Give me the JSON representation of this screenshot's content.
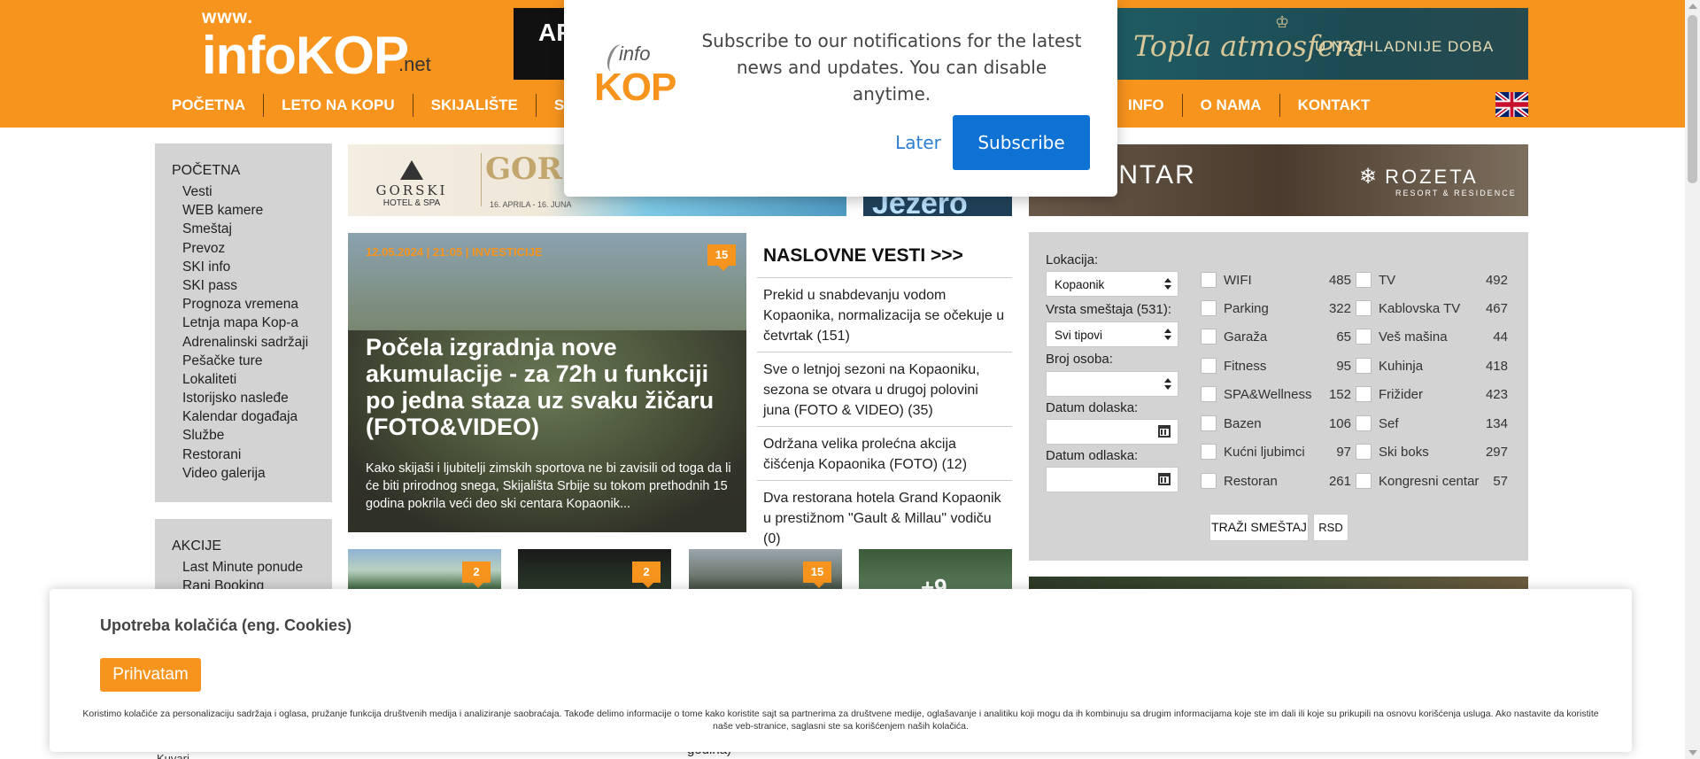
{
  "header": {
    "logo_www": "www.",
    "logo_name": "infoKOP",
    "logo_tld": ".net",
    "top_ad_left_text": "AP",
    "top_ad_right_script": "Topla atmosfera",
    "top_ad_right_caps": "U NAJHLADNIJE DOBA"
  },
  "nav": {
    "left": [
      "POČETNA",
      "LETO NA KOPU",
      "SKIJALIŠTE",
      "SMEŠTAJ"
    ],
    "right": [
      "INFO",
      "O NAMA",
      "KONTAKT"
    ],
    "language_flag": "uk-flag-icon"
  },
  "sidebar": {
    "section1_title": "POČETNA",
    "section1_items": [
      "Vesti",
      "WEB kamere",
      "Smeštaj",
      "Prevoz",
      "SKI info",
      "SKI pass",
      "Prognoza vremena",
      "Letnja mapa Kop-a",
      "Adrenalinski sadržaji",
      "Pešačke ture",
      "Lokaliteti",
      "Istorijsko nasleđe",
      "Kalendar događaja",
      "Službe",
      "Restorani",
      "Video galerija"
    ],
    "section2_title": "AKCIJE",
    "section2_items": [
      "Last Minute ponude",
      "Rani Booking"
    ],
    "bottom_peek": "Kuvari"
  },
  "ads": {
    "gorski_brand": "GORSKI",
    "gorski_brand_sub": "HOTEL & SPA",
    "gorski_script": "GORSKI refresh",
    "gorski_dates": "16. APRILA - 16. JUNA",
    "jezero": "Jezero",
    "rozeta_word": "A CENTAR",
    "rozeta_logo": "ROZETA",
    "rozeta_sub": "RESORT & RESIDENCE"
  },
  "featured": {
    "meta": "12.05.2024 | 21:05 | INVESTICIJE",
    "comments": "15",
    "title": "Počela izgradnja nove akumulacije - za 72h u funkciji po jedna staza uz svaku žičaru (FOTO&VIDEO)",
    "excerpt": "Kako skijaši i ljubitelji zimskih sportova ne bi zavisili od toga da li će biti prirodnog snega, Skijališta Srbije su tokom prethodnih 15 godina pokrila veći deo ski centara Kopaonik..."
  },
  "headlines": {
    "title": "NASLOVNE VESTI >>>",
    "items": [
      "Prekid u snabdevanju vodom Kopaonika, normalizacija se očekuje u četvrtak (151)",
      "Sve o letnjoj sezoni na Kopaoniku, sezona se otvara u drugoj polovini juna (FOTO & VIDEO) (35)",
      "Održana velika prolećna akcija čišćenja Kopaonika (FOTO) (12)",
      "Dva restorana hotela Grand Kopaonik u prestižnom \"Gault & Millau\" vodiču (0)"
    ]
  },
  "thumbs": [
    {
      "comments": "2"
    },
    {
      "comments": "2"
    },
    {
      "comments": "15"
    },
    {
      "overlay": "+9"
    }
  ],
  "middle_bottom_peek": "godina)",
  "search": {
    "location_label": "Lokacija:",
    "location_value": "Kopaonik",
    "type_label": "Vrsta smeštaja (531):",
    "type_value": "Svi tipovi",
    "persons_label": "Broj osoba:",
    "persons_value": "",
    "arrival_label": "Datum dolaska:",
    "departure_label": "Datum odlaska:",
    "amenities_left": [
      {
        "label": "WIFI",
        "count": "485"
      },
      {
        "label": "Parking",
        "count": "322"
      },
      {
        "label": "Garaža",
        "count": "65"
      },
      {
        "label": "Fitness",
        "count": "95"
      },
      {
        "label": "SPA&Wellness",
        "count": "152"
      },
      {
        "label": "Bazen",
        "count": "106"
      },
      {
        "label": "Kućni ljubimci",
        "count": "97"
      },
      {
        "label": "Restoran",
        "count": "261"
      }
    ],
    "amenities_right": [
      {
        "label": "TV",
        "count": "492"
      },
      {
        "label": "Kablovska TV",
        "count": "467"
      },
      {
        "label": "Veš mašina",
        "count": "44"
      },
      {
        "label": "Kuhinja",
        "count": "418"
      },
      {
        "label": "Frižider",
        "count": "423"
      },
      {
        "label": "Sef",
        "count": "134"
      },
      {
        "label": "Ski boks",
        "count": "297"
      },
      {
        "label": "Kongresni centar",
        "count": "57"
      }
    ],
    "search_button": "TRAŽI SMEŠTAJ",
    "currency_button": "RSD"
  },
  "notification": {
    "logo_info": "info",
    "logo_kop": "KOP",
    "text": "Subscribe to our notifications for the latest news and updates. You can disable anytime.",
    "later": "Later",
    "subscribe": "Subscribe"
  },
  "cookie": {
    "title": "Upotreba kolačića (eng. Cookies)",
    "accept": "Prihvatam",
    "text": "Koristimo kolačiće za personalizaciju sadržaja i oglasa, pružanje funkcija društvenih medija i analiziranje saobraćaja. Takođe delimo informacije o tome kako koristite sajt sa partnerima za društvene medije, oglašavanje i analitiku koji mogu da ih kombinuju sa drugim informacijama koje ste im dali ili koje su prikupili na osnovu korišćenja usluga. Ako nastavite da koristite naše veb-stranice, saglasni ste sa korišćenjem naših kolačića."
  },
  "colors": {
    "brand_orange": "#f7941d",
    "subscribe_blue": "#0d72d4",
    "sidebar_gray": "#d3d3d3"
  }
}
